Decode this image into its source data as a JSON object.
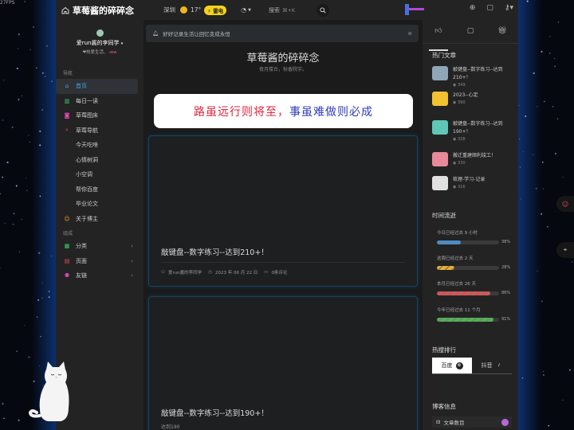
{
  "fps": "27FPS",
  "header": {
    "site_title": "草莓酱的碎碎念",
    "city": "深圳",
    "temperature": "17°",
    "weather_badge": "雷电",
    "search_label": "搜索",
    "search_kbd": "⌘+K"
  },
  "sidebar": {
    "username": "爱run酱的李同学",
    "motto_prefix": "❤热爱生活、",
    "motto_suffix": "-ww",
    "section_nav": "导航",
    "section_group": "组成",
    "nav_items": [
      {
        "label": "首页",
        "icon": "home-icon",
        "color": "#4aa3e0"
      },
      {
        "label": "每日一读",
        "icon": "book-icon",
        "color": "#3bd16f"
      },
      {
        "label": "草莓图床",
        "icon": "camera-icon",
        "color": "#e04ab5"
      },
      {
        "label": "草莓导航",
        "icon": "search-icon",
        "color": "#e04a6a"
      }
    ],
    "sub_items": [
      "今天吃啥",
      "心情树洞",
      "小空调",
      "帮你百度",
      "毕业论文"
    ],
    "about_item": {
      "label": "关于博主",
      "icon": "emoji-icon",
      "color": "#f0a030"
    },
    "group_items": [
      {
        "label": "分类",
        "icon": "grid-icon",
        "color": "#3bd16f"
      },
      {
        "label": "页面",
        "icon": "page-icon",
        "color": "#e85050"
      },
      {
        "label": "友链",
        "icon": "user-icon",
        "color": "#e04ab5"
      }
    ]
  },
  "main": {
    "notice": "好好记录生活让回忆变成永恒",
    "blog_title": "草莓酱的碎碎念",
    "blog_subtitle": "夜月楼台，秋香院宇。",
    "motto_part1": "路虽远行则将至，",
    "motto_part2": "事虽难做则必成",
    "motto_color1": "#e0243c",
    "motto_color2": "#2d3bb8",
    "posts": [
      {
        "title": "敲键盘--数字练习--达到210+！",
        "author": "爱run酱的李同学",
        "date": "2023 年 06 月 22 日",
        "comments": "0条评论"
      },
      {
        "title": "敲键盘--数字练习--达到190+！",
        "excerpt": "达到190"
      }
    ]
  },
  "right": {
    "hot_heading": "热门文章",
    "hot_posts": [
      {
        "title": "敲键盘--数字练习--达到210+！",
        "views": "349",
        "thumb_color": "#8fa6b6"
      },
      {
        "title": "2023--心定",
        "views": "390",
        "thumb_color": "#f2c230"
      },
      {
        "title": "敲键盘--数字练习--达到190+！",
        "views": "328",
        "thumb_color": "#5fc6b8"
      },
      {
        "title": "搬迁重建顺利竣工！",
        "views": "330",
        "thumb_color": "#e8889a"
      },
      {
        "title": "梳理-学习-记录",
        "views": "316",
        "thumb_color": "#e0e0e0"
      }
    ],
    "time_heading": "时间流逝",
    "time_items": [
      {
        "label": "今日已经过去 9 小时",
        "percent": 38,
        "color": "#3a8fe0"
      },
      {
        "label": "这周已经过去 2 天",
        "percent": 28,
        "color": "#f0b020"
      },
      {
        "label": "本月已经过去 26 天",
        "percent": 86,
        "color": "#e84a4a"
      },
      {
        "label": "今年已经过去 11 个月",
        "percent": 91,
        "color": "#4ab84a"
      }
    ],
    "rank_heading": "热搜排行",
    "rank_tabs": [
      "百度",
      "抖音"
    ],
    "blog_info_heading": "博客信息",
    "stat_label": "文章数目"
  }
}
